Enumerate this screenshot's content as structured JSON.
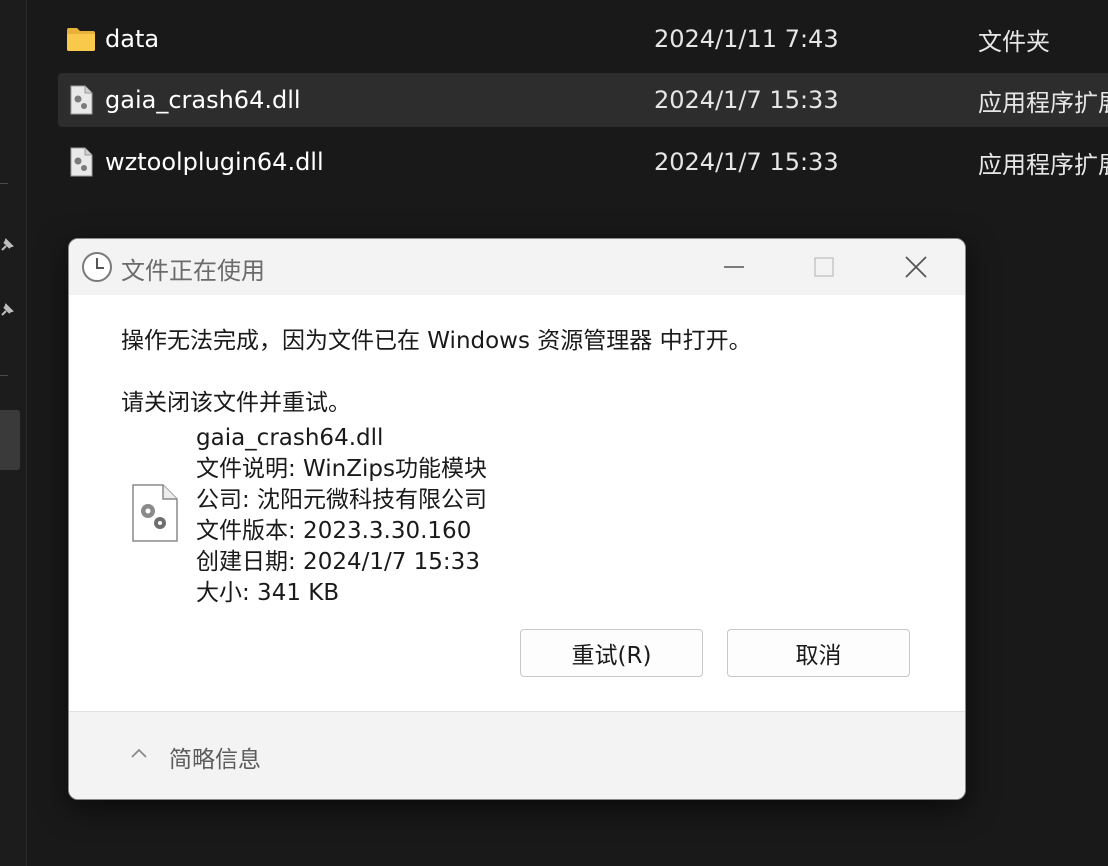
{
  "files": [
    {
      "name": "data",
      "date": "2024/1/11 7:43",
      "type": "文件夹",
      "icon": "folder-icon"
    },
    {
      "name": "gaia_crash64.dll",
      "date": "2024/1/7 15:33",
      "type": "应用程序扩展",
      "icon": "dll-file-icon"
    },
    {
      "name": "wztoolplugin64.dll",
      "date": "2024/1/7 15:33",
      "type": "应用程序扩展",
      "icon": "dll-file-icon"
    }
  ],
  "dialog": {
    "title": "文件正在使用",
    "message": "操作无法完成，因为文件已在 Windows 资源管理器 中打开。",
    "instruction": "请关闭该文件并重试。",
    "file_info": {
      "name": "gaia_crash64.dll",
      "description": "文件说明: WinZips功能模块",
      "company": "公司: 沈阳元微科技有限公司",
      "version": "文件版本: 2023.3.30.160",
      "created": "创建日期: 2024/1/7 15:33",
      "size": "大小: 341 KB"
    },
    "buttons": {
      "retry": "重试(R)",
      "cancel": "取消"
    },
    "footer_label": "简略信息"
  },
  "colors": {
    "explorer_bg": "#191919",
    "selected_row": "#2d2d2d",
    "folder": "#f8c94a",
    "dialog_bg": "#ffffff",
    "titlebar_bg": "#f3f3f3"
  }
}
